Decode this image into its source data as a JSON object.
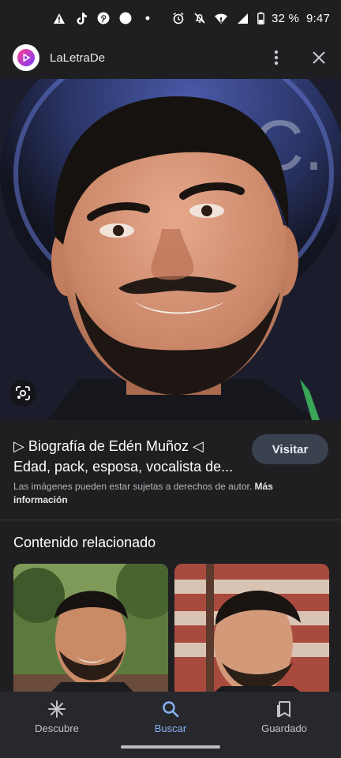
{
  "status_bar": {
    "battery_text": "32 %",
    "time": "9:47",
    "left_icons": [
      "warning-icon",
      "tiktok-icon",
      "pinterest-icon",
      "record-icon",
      "dot-icon"
    ],
    "right_icons": [
      "alarm-icon",
      "mute-icon",
      "wifi-icon",
      "signal-icon",
      "battery-icon"
    ]
  },
  "header": {
    "site_name": "LaLetraDe",
    "logo_icon": "laletrade-logo-icon",
    "menu_icon": "more-vert-icon",
    "close_icon": "close-icon"
  },
  "result": {
    "title_line1": "▷ Biografía de Edén Muñoz ◁",
    "title_line2": "Edad, pack, esposa, vocalista de...",
    "visit_label": "Visitar",
    "disclaimer_text": "Las imágenes pueden estar sujetas a derechos de autor.",
    "disclaimer_link": "Más información"
  },
  "related": {
    "title": "Contenido relacionado"
  },
  "bottom_nav": {
    "items": [
      {
        "label": "Descubre",
        "icon": "asterisk-icon",
        "active": false
      },
      {
        "label": "Buscar",
        "icon": "search-icon",
        "active": true
      },
      {
        "label": "Guardado",
        "icon": "bookmarks-icon",
        "active": false
      }
    ]
  },
  "colors": {
    "background": "#1f1f22",
    "accent": "#8ab4f8",
    "visit_button": "#3a4250",
    "nav_background": "#27282c"
  }
}
